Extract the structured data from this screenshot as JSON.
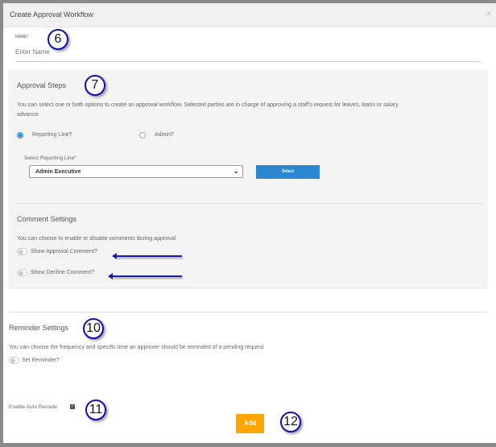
{
  "modal": {
    "title": "Create Approval Workflow",
    "close_icon": "×"
  },
  "name_field": {
    "label": "NAME",
    "required_mark": "*",
    "placeholder": "Enter Name",
    "value": ""
  },
  "approval_steps": {
    "heading": "Approval Steps",
    "description_line1": "You can select one or both options to create an approval workflow. Selected parties are in charge of approving a staff's request for leaves, loans or salary",
    "description_line2": "advance",
    "options": [
      {
        "label": "Reporting Line?",
        "selected": true
      },
      {
        "label": "Admin?",
        "selected": false
      }
    ],
    "select_label": "Select Reporting Line",
    "required_mark": "*",
    "select_value": "Admin Executive",
    "select_button": "Select"
  },
  "comment_settings": {
    "heading": "Comment Settings",
    "description": "You can choose to enable or disable comments during approval",
    "toggles": [
      {
        "label": "Show Approval Comment?",
        "on": false
      },
      {
        "label": "Show Decline Comment?",
        "on": false
      }
    ]
  },
  "reminder_settings": {
    "heading": "Reminder Settings",
    "description": "You can choose the frequency and specific time an approver should be reminded of a pending request",
    "toggle": {
      "label": "Set Reminder?",
      "on": false
    }
  },
  "auto_reroute": {
    "label": "Enable Auto Reroute:",
    "checked": true,
    "check_glyph": "✓"
  },
  "add_button": "Add",
  "annotations": [
    "6",
    "7",
    "10",
    "11",
    "12"
  ],
  "colors": {
    "primary": "#2b87d0",
    "accent": "#ffa500",
    "annotation": "#1010b0"
  }
}
